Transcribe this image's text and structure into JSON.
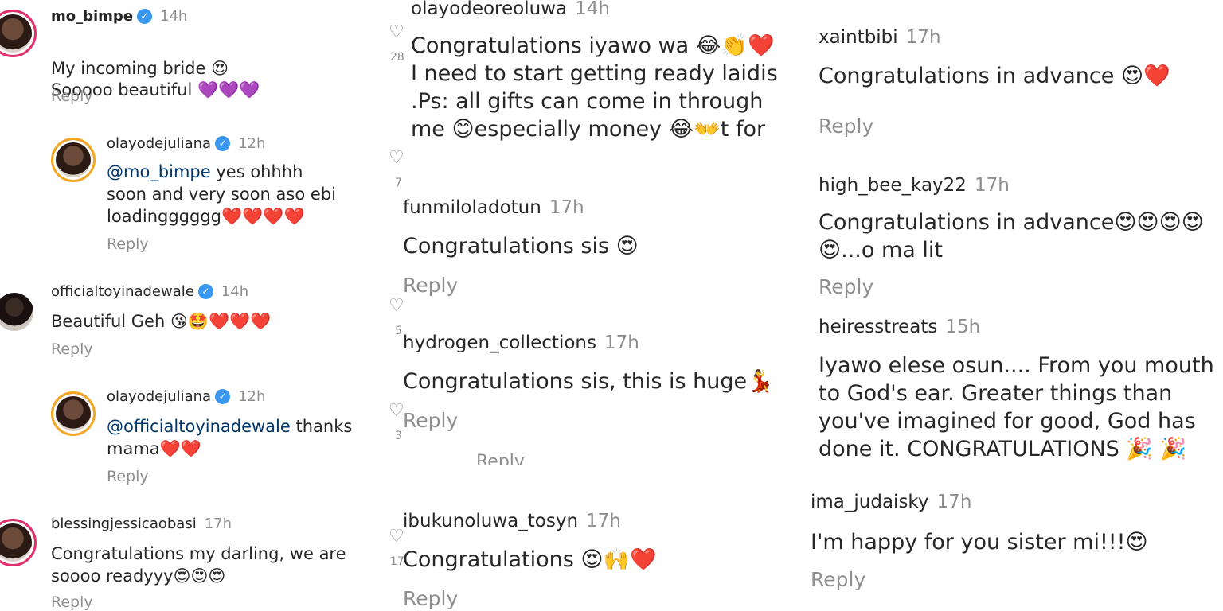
{
  "left": {
    "c1": {
      "user": "mo_bimpe",
      "time": "14h",
      "line1": "My incoming bride 😍",
      "line2": "Sooooo beautiful 💜💜💜",
      "reply": "Reply"
    },
    "r1": {
      "user": "olayodejuliana",
      "time": "12h",
      "mention": "@mo_bimpe",
      "text": " yes ohhhh\nsoon and very soon aso ebi\nloadingggggg❤️❤️❤️❤️",
      "reply": "Reply"
    },
    "c2": {
      "user": "officialtoyinadewale",
      "time": "14h",
      "text": "Beautiful Geh 😘🤩❤️❤️❤️",
      "reply": "Reply"
    },
    "r2": {
      "user": "olayodejuliana",
      "time": "12h",
      "mention": "@officialtoyinadewale",
      "text": " thanks\nmama❤️❤️",
      "reply": "Reply"
    },
    "c3": {
      "user": "blessingjessicaobasi",
      "time": "17h",
      "text": "Congratulations my darling, we are\nsoooo readyyy😍😍😍",
      "reply": "Reply"
    }
  },
  "middle": {
    "c1": {
      "user": "olayodeoreoluwa",
      "time": "14h",
      "text": "Congratulations iyawo wa 😂👏❤️\nI need to start getting ready laidis\n        .Ps: all gifts can come in through\nme 😊especially money 😂👐t for"
    },
    "c2": {
      "user": "funmiloladotun",
      "time": "17h",
      "text": "Congratulations sis 😍",
      "reply": "Reply"
    },
    "c3": {
      "user": "hydrogen_collections",
      "time": "17h",
      "text": "Congratulations sis, this is huge💃",
      "reply": "Reply"
    },
    "ghost_reply": "Reply",
    "c4": {
      "user": "ibukunoluwa_tosyn",
      "time": "17h",
      "text": "Congratulations 😍🙌❤️",
      "reply": "Reply"
    },
    "counts": {
      "a": "28",
      "b": "7",
      "c": "5",
      "d": "3",
      "e": "17"
    }
  },
  "right": {
    "c1": {
      "user": "xaintbibi",
      "time": "17h",
      "text": "Congratulations in advance 😍❤️",
      "reply": "Reply"
    },
    "c2": {
      "user": "high_bee_kay22",
      "time": "17h",
      "text": "Congratulations in advance😍😍😍😍\n😍...o ma lit",
      "reply": "Reply"
    },
    "c3": {
      "user": "heiresstreats",
      "time": "15h",
      "text": "Iyawo elese osun.... From you mouth\nto God's ear. Greater things than\nyou've imagined for good, God has\ndone it. CONGRATULATIONS 🎉 🎉"
    },
    "c4": {
      "user": "ima_judaisky",
      "time": "17h",
      "text": "I'm happy for you sister mi!!!😍",
      "reply": "Reply"
    }
  },
  "colors": {
    "verified": "#3897f0",
    "muted": "#8e8e8e",
    "mention": "#00376b",
    "story_ring": "#e1306c"
  },
  "icons": {
    "verified": "check-icon",
    "like": "heart-outline-icon"
  }
}
